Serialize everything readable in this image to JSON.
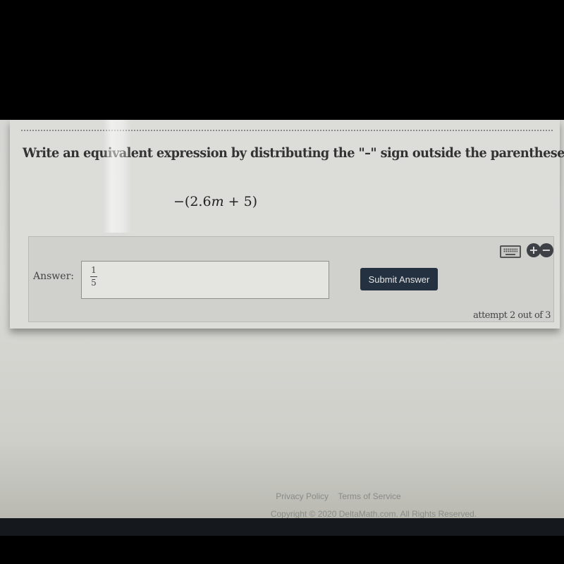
{
  "question": {
    "prompt": "Write an equivalent expression by distributing the \"–\" sign outside the parentheses:",
    "expression_prefix": "−(2.6",
    "expression_var": "m",
    "expression_suffix": " + 5)"
  },
  "answer": {
    "label": "Answer:",
    "value_numerator": "1",
    "value_denominator": "5",
    "submit_label": "Submit Answer",
    "attempt_text": "attempt 2 out of 3"
  },
  "tools": {
    "keyboard_icon": "keyboard-icon",
    "zoom_in_glyph": "+",
    "zoom_out_glyph": "−"
  },
  "footer": {
    "links": [
      "Privacy Policy",
      "Terms of Service"
    ],
    "copyright": "Copyright © 2020 DeltaMath.com. All Rights Reserved."
  },
  "colors": {
    "submit_button": "#233140",
    "tool_buttons": "#3d4045"
  }
}
